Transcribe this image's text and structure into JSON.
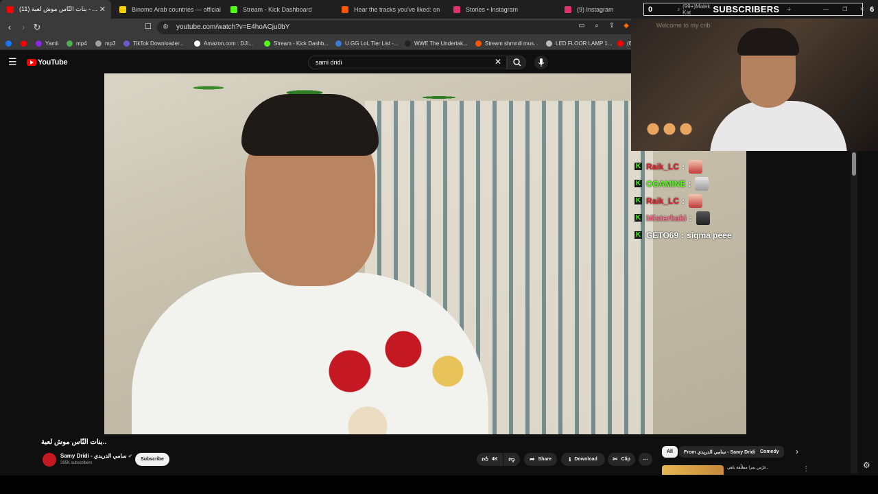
{
  "tabs": [
    {
      "label": "(11) بنات النّاس موش لعبة - ...",
      "active": true,
      "color": "#ff0000"
    },
    {
      "label": "Binomo Arab countries — official site",
      "active": false,
      "color": "#f5d000"
    },
    {
      "label": "Stream - Kick Dashboard",
      "active": false,
      "color": "#53fc18"
    },
    {
      "label": "Hear the tracks you've liked: on SoundCloud",
      "active": false,
      "color": "#ff5500"
    },
    {
      "label": "Stories • Instagram",
      "active": false,
      "color": "#e1306c"
    },
    {
      "label": "(9) Instagram",
      "active": false,
      "color": "#e1306c"
    }
  ],
  "address": {
    "url": "youtube.com/watch?v=E4hoACju0bY"
  },
  "bookmarks": [
    {
      "label": "",
      "color": "#1877f2"
    },
    {
      "label": "",
      "color": "#ff0000"
    },
    {
      "label": "Yamli",
      "color": "#8a2be2"
    },
    {
      "label": "mp4",
      "color": "#4caf50"
    },
    {
      "label": "mp3",
      "color": "#9e9e9e"
    },
    {
      "label": "TikTok Downloader...",
      "color": "#6a5acd"
    },
    {
      "label": "Amazon.com : DJI...",
      "color": "#ffffff"
    },
    {
      "label": "Stream - Kick Dashb...",
      "color": "#53fc18"
    },
    {
      "label": "U.GG LoL Tier List -...",
      "color": "#3a7bd5"
    },
    {
      "label": "WWE The Undertak...",
      "color": "#222222"
    },
    {
      "label": "Stream shmndl mus...",
      "color": "#ff5500"
    },
    {
      "label": "LED FLOOR LAMP 1...",
      "color": "#bbbbbb"
    },
    {
      "label": "(6",
      "color": "#ff0000"
    }
  ],
  "youtube": {
    "logo_text": "YouTube",
    "search_value": "sami dridi"
  },
  "overlay": {
    "subs_left": "0",
    "subs_mid": "(99+)Malek Kat",
    "subs_label": "SUBSCRIBERS",
    "subs_right": "6",
    "cam_text": "Welcome to my crib"
  },
  "chat": [
    {
      "user": "Raik_LC",
      "user_color": "#e8202b",
      "message": ""
    },
    {
      "user": "OGAMINE",
      "user_color": "#53fc18",
      "message": ""
    },
    {
      "user": "Raik_LC",
      "user_color": "#e8202b",
      "message": ""
    },
    {
      "user": "Misterkaki",
      "user_color": "#ff6b8b",
      "message": ""
    },
    {
      "user": "GETO69",
      "user_color": "#ffffff",
      "message": "sigma peee"
    }
  ],
  "video_info": {
    "title": "بنات النّاس موش لعبة..",
    "channel": "Samy Dridi - سامي الدريدي",
    "subscribers": "395K subscribers",
    "subscribe_label": "Subscribe",
    "likes": "4K",
    "share_label": "Share",
    "download_label": "Download",
    "clip_label": "Clip"
  },
  "chips": [
    {
      "label": "All",
      "selected": true
    },
    {
      "label": "From سامي الدريدي - Samy Dridi",
      "selected": false
    },
    {
      "label": "Comedy",
      "selected": false
    }
  ],
  "recommendation": {
    "title": "عرّس بمرا مطلّقة باهي.."
  }
}
